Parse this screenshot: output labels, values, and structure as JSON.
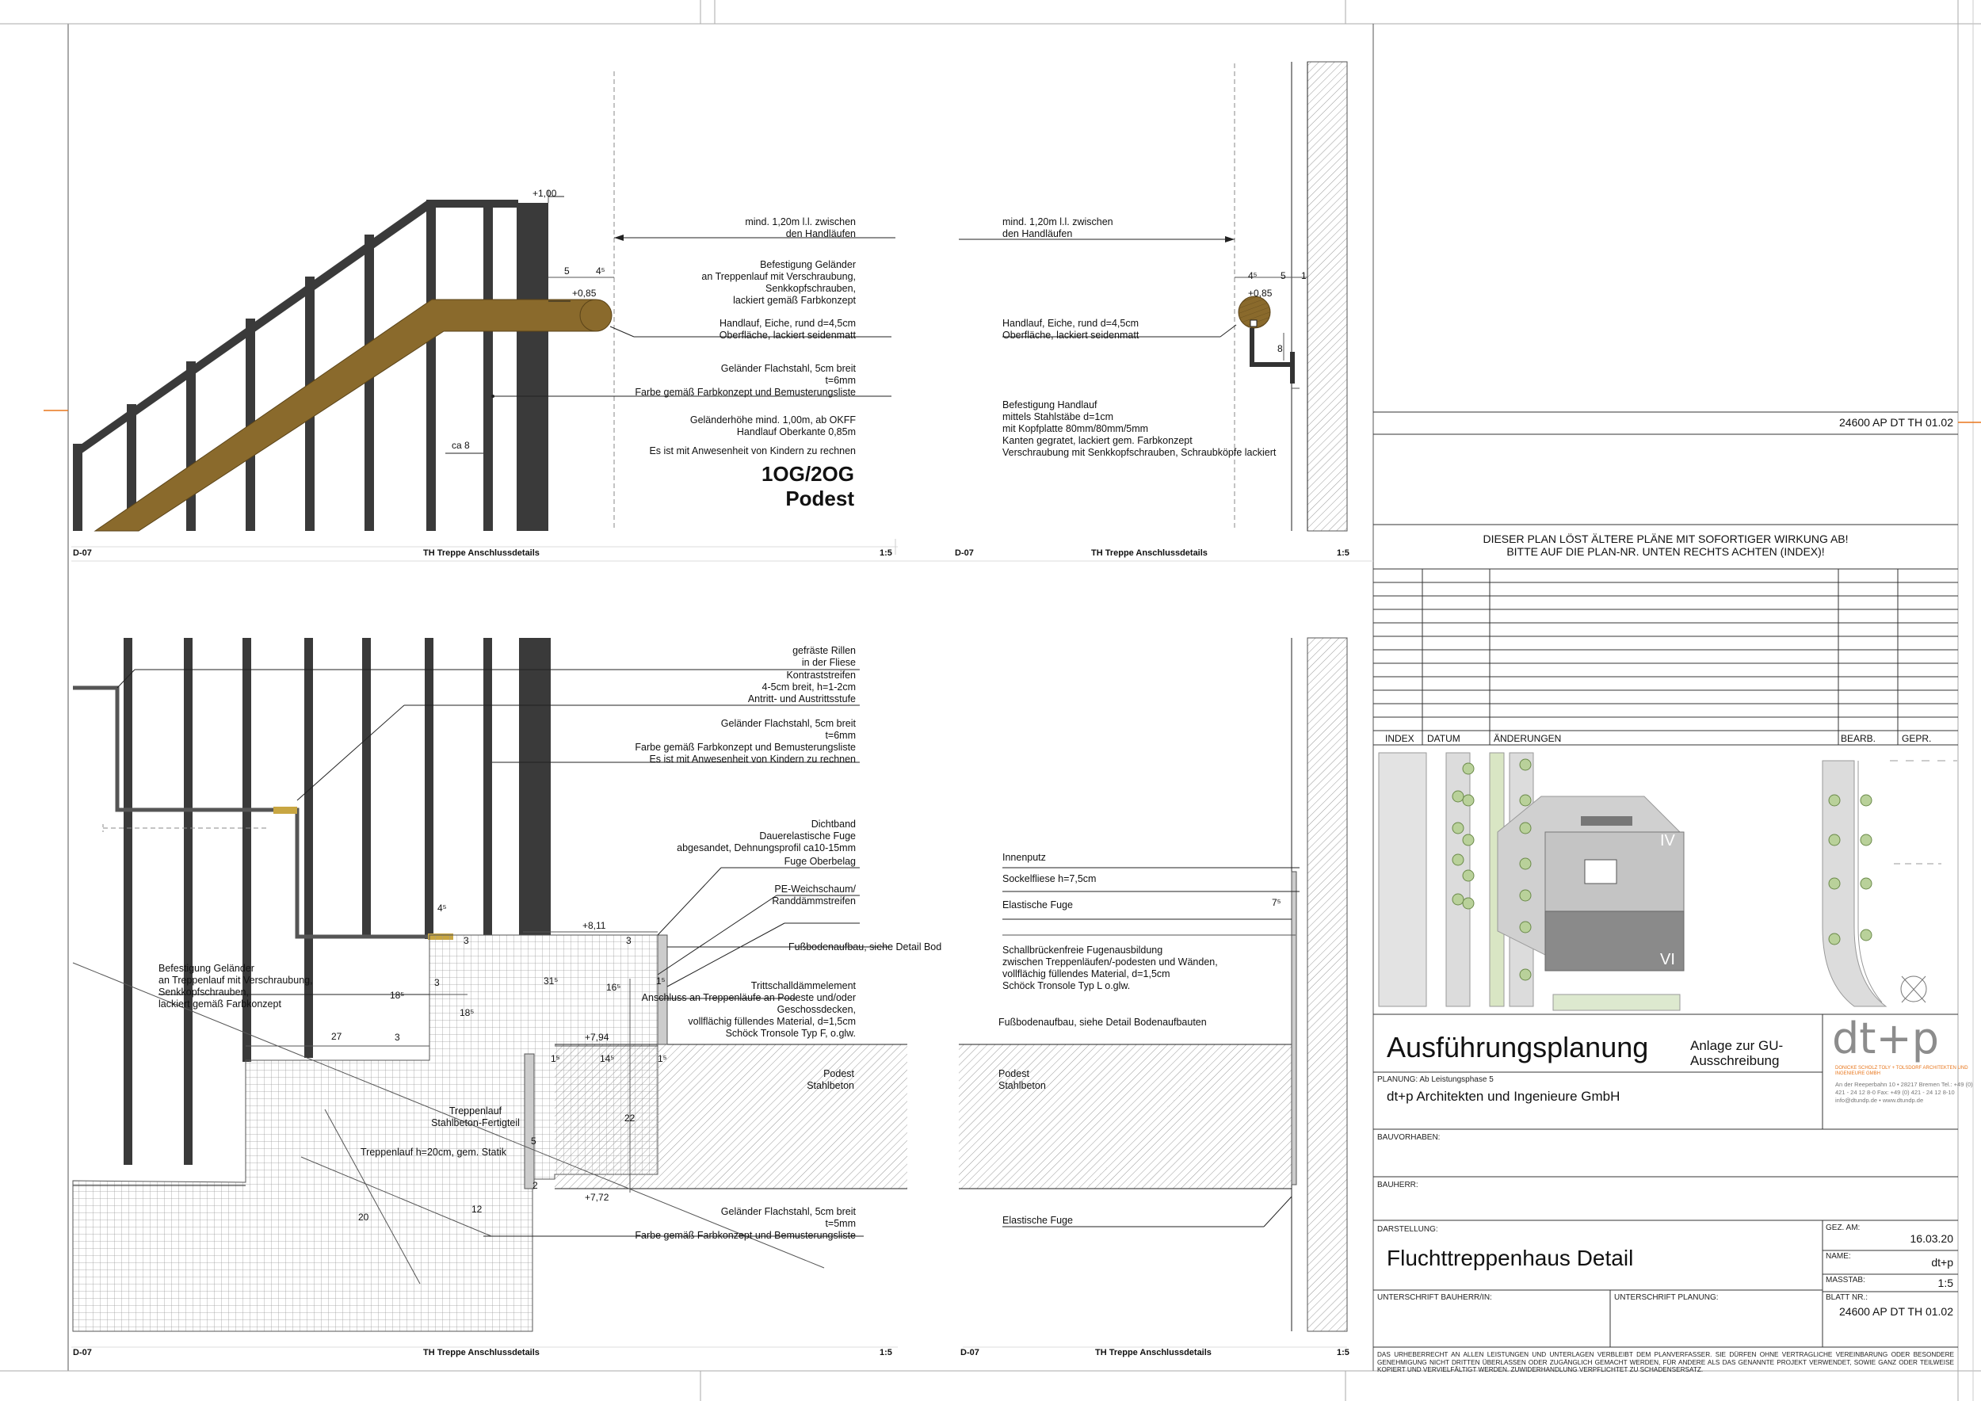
{
  "colors": {
    "steel_dark": "#3a3a3a",
    "wood_brown": "#8a6a2c",
    "wood_edge": "#5a4318",
    "orange_accent": "#e8761c",
    "logo_grey": "#8c8c8c",
    "hatch_grey": "#bdbdbd"
  },
  "details": {
    "top_left": {
      "code": "D-07",
      "title": "TH Treppe Anschlussdetails",
      "scale": "1:5",
      "heading_line1": "1OG/2OG",
      "heading_line2": "Podest",
      "level_top": "+1,00",
      "level_handrail": "+0,85",
      "dim_a": "5",
      "dim_b": "4⁵",
      "dim_ca8": "ca 8",
      "note1": "mind. 1,20m l.l. zwischen\nden Handläufen",
      "note2": "Befestigung Geländer\nan Treppenlauf mit Verschraubung,\nSenkkopfschrauben,\nlackiert gemäß Farbkonzept",
      "note3": "Handlauf, Eiche, rund d=4,5cm\nOberfläche, lackiert seidenmatt",
      "note4": "Geländer Flachstahl, 5cm breit\nt=6mm\nFarbe gemäß Farbkonzept und Bemusterungsliste",
      "note5": "Geländerhöhe mind. 1,00m, ab OKFF\nHandlauf Oberkante 0,85m",
      "note6": "Es ist mit Anwesenheit von Kindern zu rechnen"
    },
    "top_right": {
      "code": "D-07",
      "title": "TH Treppe Anschlussdetails",
      "scale": "1:5",
      "level_handrail": "+0,85",
      "dim_a": "4⁵",
      "dim_b": "5",
      "dim_c": "1",
      "dim_d": "8",
      "note1": "mind. 1,20m l.l. zwischen\nden Handläufen",
      "note2": "Handlauf, Eiche, rund d=4,5cm\nOberfläche, lackiert seidenmatt",
      "note3": "Befestigung Handlauf\nmittels Stahlstäbe d=1cm\nmit Kopfplatte 80mm/80mm/5mm\nKanten gegratet, lackiert gem. Farbkonzept\nVerschraubung mit Senkkopfschrauben, Schraubköpfe lackiert"
    },
    "bottom_left": {
      "code": "D-07",
      "title": "TH Treppe Anschlussdetails",
      "scale": "1:5",
      "note1": "gefräste Rillen\nin der Fliese",
      "note2": "Kontraststreifen\n4-5cm breit, h=1-2cm\nAntritt- und Austrittsstufe",
      "note3": "Geländer Flachstahl, 5cm breit\nt=6mm\nFarbe gemäß Farbkonzept und Bemusterungsliste\nEs ist mit Anwesenheit von Kindern zu rechnen",
      "note4": "Dichtband\nDauerelastische Fuge\nabgesandet, Dehnungsprofil ca10-15mm",
      "note5": "Fuge Oberbelag",
      "note6": "PE-Weichschaum/\nRanddämmstreifen",
      "note7": "Fußbodenaufbau, siehe Detail Bod",
      "note8": "Trittschalldämmelement\nAnschluss an Treppenläufe an Podeste und/oder\nGeschossdecken,\nvollflächig füllendes Material, d=1,5cm\nSchöck Tronsole Typ F, o.glw.",
      "note9": "Befestigung Geländer\nan Treppenlauf mit Verschraubung,\nSenkkopfschrauben,\nlackiert gemäß Farbkonzept",
      "note10": "Geländer Flachstahl, 5cm breit\nt=5mm\nFarbe gemäß Farbkonzept und Bemusterungsliste",
      "label_podest": "Podest\nStahlbeton",
      "label_treppenlauf": "Treppenlauf\nStahlbeton-Fertigteil",
      "label_h20": "Treppenlauf h=20cm, gem. Statik",
      "lvl1": "+8,11",
      "lvl2": "+7,94",
      "lvl3": "+7,72",
      "d_45": "4⁵",
      "d_27": "27",
      "d_3a": "3",
      "d_3b": "3",
      "d_3c": "3",
      "d_315": "31⁵",
      "d_18a": "18⁵",
      "d_18b": "18⁵",
      "d_16": "16⁵",
      "d_14": "14⁵",
      "d_1a": "1⁵",
      "d_1b": "1⁵",
      "d_22": "22",
      "d_5": "5",
      "d_20": "20",
      "d_12": "12",
      "d_2": "2",
      "d_1c": "1⁵",
      "d_3d": "3"
    },
    "bottom_right": {
      "code": "D-07",
      "title": "TH Treppe Anschlussdetails",
      "scale": "1:5",
      "note1": "Innenputz",
      "note2": "Sockelfliese h=7,5cm",
      "note3": "Elastische Fuge",
      "note4": "Schallbrückenfreie Fugenausbildung\nzwischen Treppenläufen/-podesten und Wänden,\nvollflächig füllendes Material, d=1,5cm\nSchöck Tronsole Typ L o.glw.",
      "note5": "Fußbodenaufbau, siehe Detail Bodenaufbauten",
      "note6": "Elastische Fuge",
      "label_podest": "Podest\nStahlbeton",
      "d_75": "7⁵"
    }
  },
  "title_block": {
    "plan_number_top": "24600 AP DT TH 01.02",
    "notice": "DIESER PLAN LÖST ÄLTERE PLÄNE MIT SOFORTIGER WIRKUNG AB!\nBITTE AUF DIE PLAN-NR. UNTEN RECHTS ACHTEN (INDEX)!",
    "revision_headers": [
      "INDEX",
      "DATUM",
      "ÄNDERUNGEN",
      "BEARB.",
      "GEPR."
    ],
    "map_labels": [
      "IV",
      "VI"
    ],
    "phase": "Ausführungsplanung",
    "annex": "Anlage zur GU-\nAusschreibung",
    "planning_label": "PLANUNG: Ab Leistungsphase 5",
    "planner": "dt+p Architekten und Ingenieure GmbH",
    "logo": "dt+p",
    "logo_sub": "DONICKE SCHOLZ TOLY + TOLSDORF\nARCHITEKTEN UND INGENIEURE GMBH",
    "logo_contact": "An der Reeperbahn 10  •  28217 Bremen\nTel.: +49 (0) 421 - 24 12 8-0\nFax: +49 (0) 421 - 24 12 8-10\ninfo@dtundp.de   •   www.dtundp.de",
    "bauvorhaben_label": "BAUVORHABEN:",
    "bauherr_label": "BAUHERR:",
    "darstellung_label": "DARSTELLUNG:",
    "darstellung": "Fluchttreppenhaus Detail",
    "gez_am_label": "GEZ. AM:",
    "gez_am": "16.03.20",
    "name_label": "NAME:",
    "name": "dt+p",
    "massstab_label": "MASSTAB:",
    "massstab": "1:5",
    "sig_bauherr_label": "UNTERSCHRIFT BAUHERR/IN:",
    "sig_planung_label": "UNTERSCHRIFT PLANUNG:",
    "blatt_label": "BLATT NR.:",
    "blatt": "24600 AP DT TH 01.02",
    "copyright": "DAS URHEBERRECHT AN ALLEN LEISTUNGEN UND UNTERLAGEN VERBLEIBT DEM PLANVERFASSER. SIE DÜRFEN OHNE VERTRAGLICHE VEREINBARUNG ODER BESONDERE GENEHMIGUNG NICHT DRITTEN ÜBERLASSEN ODER ZUGÄNGLICH GEMACHT WERDEN, FÜR ANDERE ALS DAS GENANNTE PROJEKT VERWENDET, SOWIE GANZ ODER TEILWEISE KOPIERT UND VERVIELFÄLTIGT WERDEN. ZUWIDERHANDLUNG VERPFLICHTET ZU SCHADENSERSATZ."
  }
}
